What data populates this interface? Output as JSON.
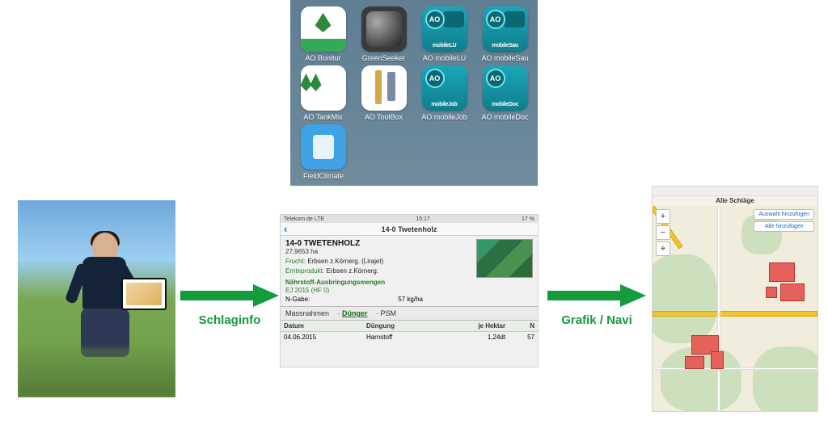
{
  "apps": {
    "row1": [
      {
        "label": "AO Bonitur"
      },
      {
        "label": "GreenSeeker"
      },
      {
        "label": "AO mobileLU",
        "sub": "mobileLU"
      },
      {
        "label": "AO mobileSau",
        "sub": "mobileSau"
      }
    ],
    "row2": [
      {
        "label": "AO TankMix"
      },
      {
        "label": "AO ToolBox"
      },
      {
        "label": "AO mobileJob",
        "sub": "mobileJob"
      },
      {
        "label": "AO mobileDoc",
        "sub": "mobileDoc"
      }
    ],
    "row3": [
      {
        "label": "FieldClimate"
      }
    ],
    "ao_badge": "AO"
  },
  "arrows": {
    "left_label": "Schlaginfo",
    "right_label": "Grafik / Navi",
    "color": "#139b3c"
  },
  "detail": {
    "carrier": "Telekom.de LTE",
    "clock": "15:17",
    "battery": "17 %",
    "nav_title": "14-0 Twetenholz",
    "field_title": "14-0 TWETENHOLZ",
    "area": "27,9653 ha",
    "frucht_k": "Frucht:",
    "frucht_v": "Erbsen z.Körnerg. (Lirajet)",
    "ernte_k": "Ernteprodukt:",
    "ernte_v": "Erbsen z.Körnerg.",
    "naehr_title": "Nährstoff-Ausbringungsmengen",
    "naehr_sub": "EJ 2015 (HF 0)",
    "ngabe_k": "N-Gabe:",
    "ngabe_v": "57 kg/ha",
    "tabs": {
      "t1": "Massnahmen",
      "t2": "Dünger",
      "t3": "PSM"
    },
    "table": {
      "headers": {
        "c1": "Datum",
        "c2": "Düngung",
        "c3": "je Hektar",
        "c4": "N"
      },
      "row": {
        "c1": "04.06.2015",
        "c2": "Harnstoff",
        "c3": "1,24dt",
        "c4": "57"
      }
    }
  },
  "map": {
    "title": "Alle Schläge",
    "zoom_in": "+",
    "zoom_out": "−",
    "locate": "⌖",
    "action1": "Auswahl hinzufügen",
    "action2": "Alle hinzufügen"
  }
}
